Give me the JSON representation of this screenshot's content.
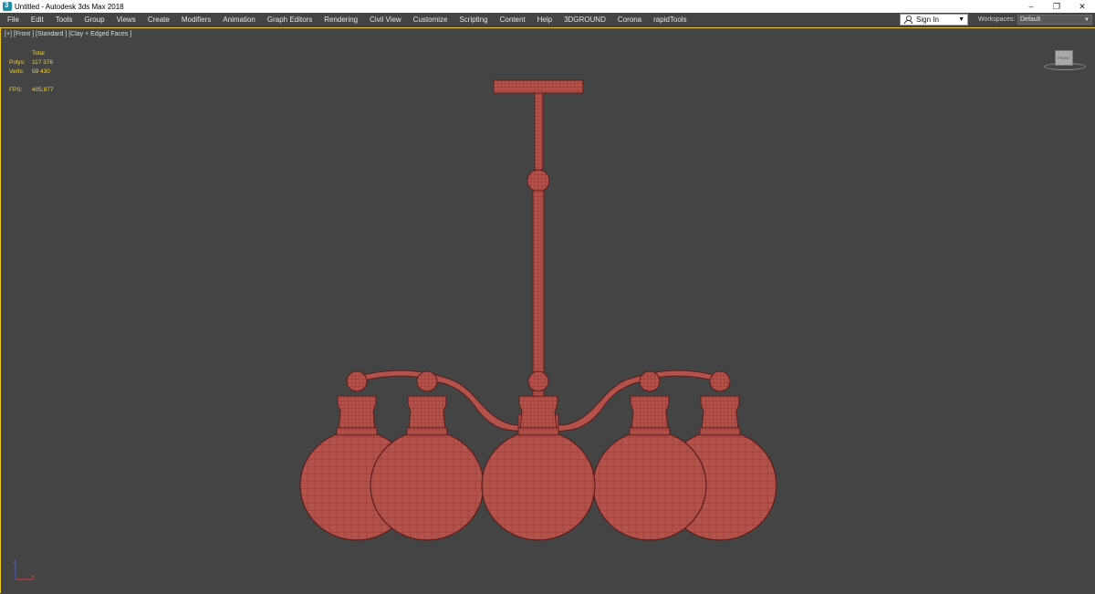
{
  "window": {
    "title": "Untitled - Autodesk 3ds Max 2018",
    "minimize_glyph": "–",
    "restore_glyph": "❐",
    "close_glyph": "✕"
  },
  "menu": {
    "items": [
      "File",
      "Edit",
      "Tools",
      "Group",
      "Views",
      "Create",
      "Modifiers",
      "Animation",
      "Graph Editors",
      "Rendering",
      "Civil View",
      "Customize",
      "Scripting",
      "Content",
      "Help",
      "3DGROUND",
      "Corona",
      "rapidTools"
    ],
    "signin_label": "Sign In",
    "workspaces_label": "Workspaces:",
    "workspace_value": "Default"
  },
  "viewport": {
    "label": "[+] [Front ] [Standard ] [Clay + Edged Faces ]",
    "stats": {
      "header": "Total",
      "polys_label": "Polys:",
      "polys_value": "117 376",
      "verts_label": "Verts:",
      "verts_value": "59 430",
      "fps_label": "FPS:",
      "fps_value": "405,877"
    },
    "viewcube_face": "FRONT",
    "model_color": "#b3524a",
    "wire_color": "#5a1e1e"
  },
  "colors": {
    "viewport_bg": "#444444",
    "active_border": "#e8c820",
    "stats_text": "#f0d12e"
  },
  "icons": [
    "app-logo-icon",
    "user-icon",
    "dropdown-arrow-icon",
    "viewcube-icon",
    "axis-tripod-icon"
  ]
}
